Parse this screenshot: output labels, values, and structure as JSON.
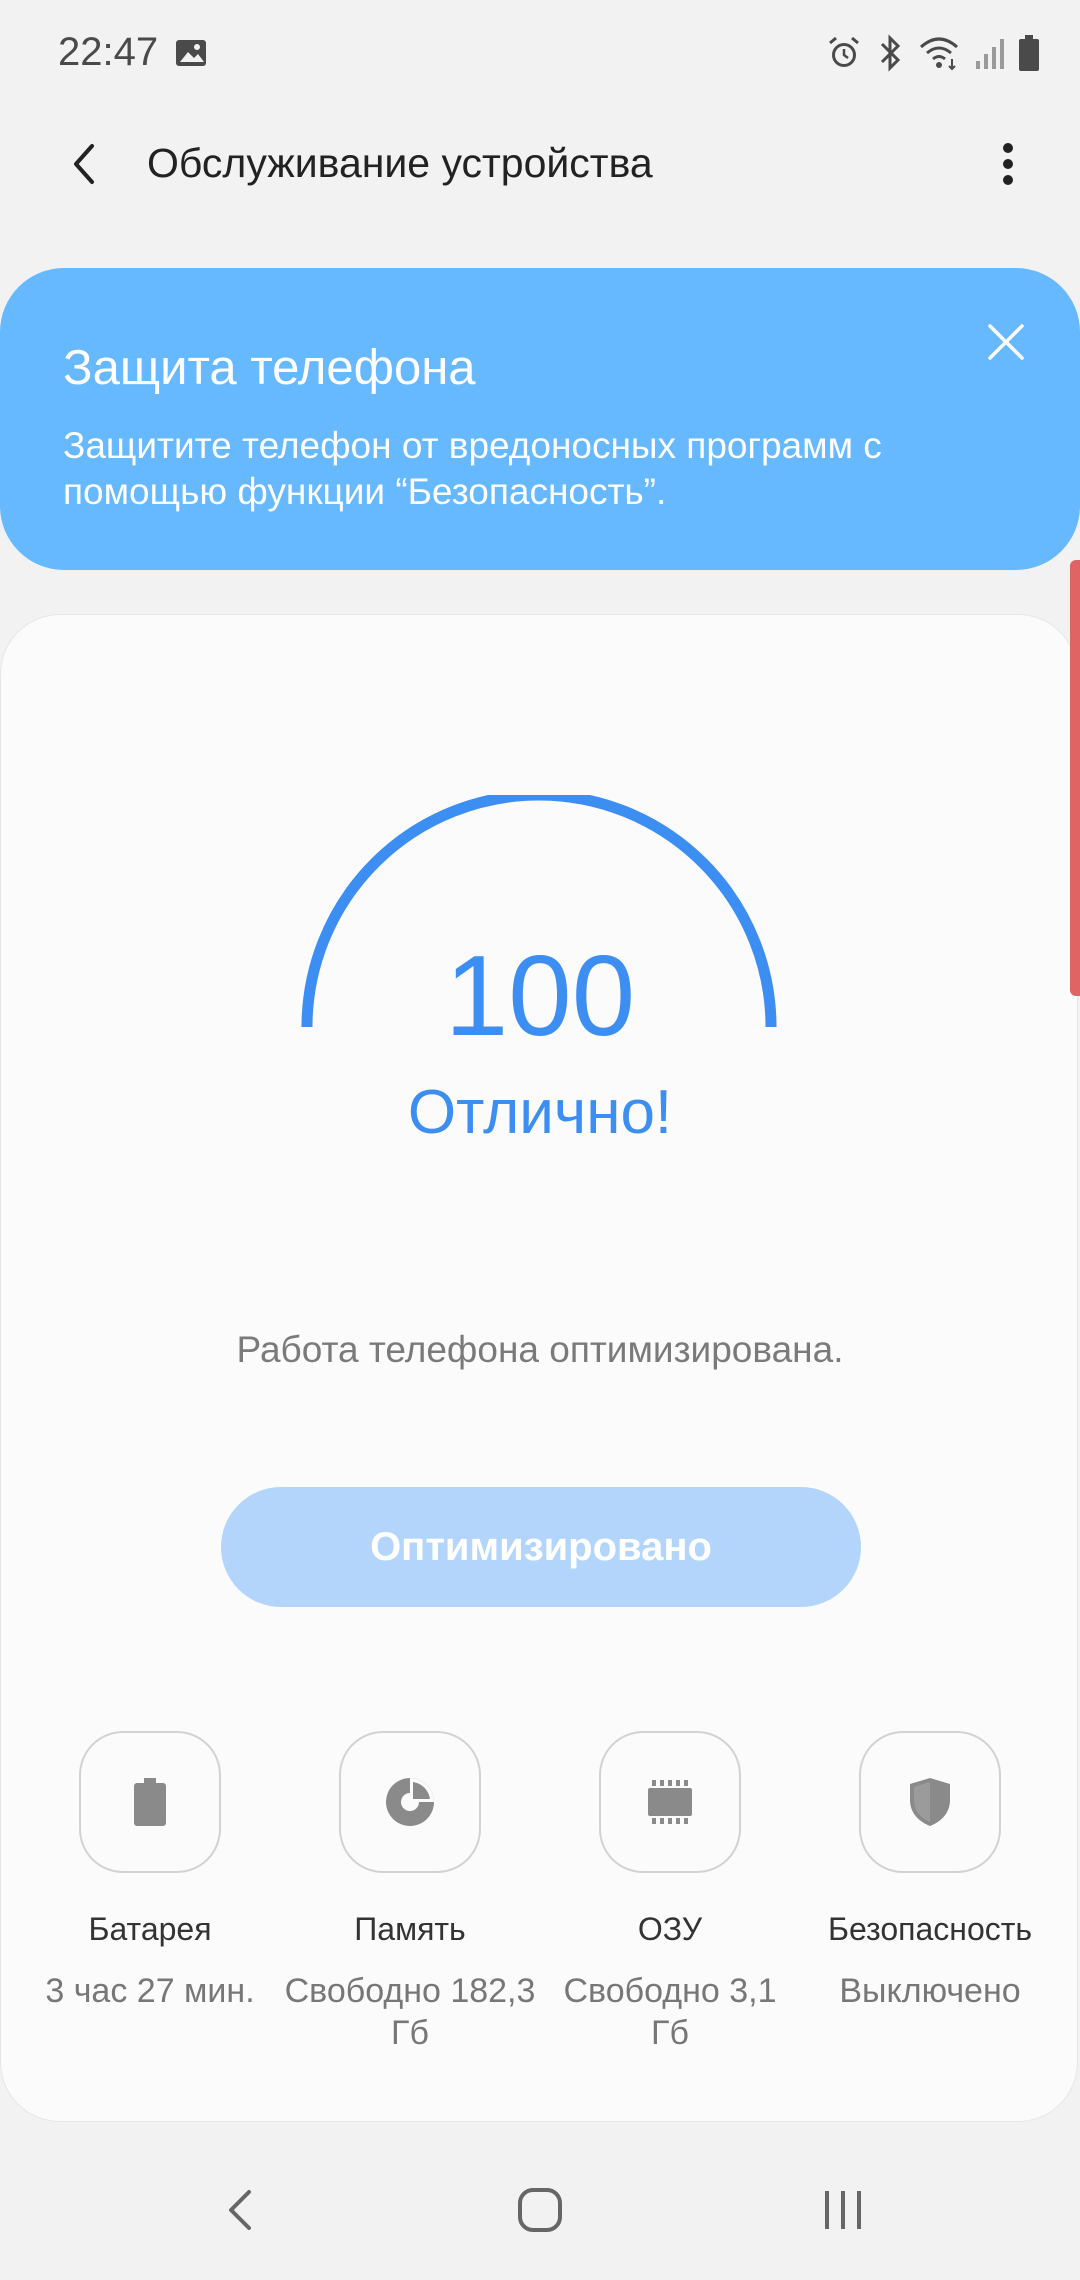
{
  "status_bar": {
    "time": "22:47",
    "icons": [
      "gallery-icon",
      "alarm-icon",
      "bluetooth-icon",
      "wifi-icon",
      "signal-icon",
      "battery-icon"
    ]
  },
  "app_bar": {
    "title": "Обслуживание устройства",
    "back_icon": "chevron-left-icon",
    "more_icon": "more-vert-icon"
  },
  "banner": {
    "title": "Защита телефона",
    "text": "Защитите телефон от вредоносных программ с помощью функции “Безопасность”.",
    "close_icon": "close-icon",
    "color": "#66b8ff"
  },
  "score": {
    "value": "100",
    "label": "Отлично!",
    "gauge_fraction": 1.0,
    "color": "#3d8ef2"
  },
  "status_message": "Работа телефона оптимизирована.",
  "optimize_button": {
    "label": "Оптимизировано",
    "color": "#b3d5fc"
  },
  "features": [
    {
      "icon": "battery-icon",
      "name": "Батарея",
      "value": "3 час 27 мин."
    },
    {
      "icon": "storage-pie-icon",
      "name": "Память",
      "value": "Свободно 182,3 Гб"
    },
    {
      "icon": "ram-chip-icon",
      "name": "ОЗУ",
      "value": "Свободно 3,1 Гб"
    },
    {
      "icon": "shield-icon",
      "name": "Безопасность",
      "value": "Выключено"
    }
  ],
  "nav_bar": {
    "back_icon": "nav-back-icon",
    "home_icon": "nav-home-icon",
    "recents_icon": "nav-recents-icon"
  }
}
